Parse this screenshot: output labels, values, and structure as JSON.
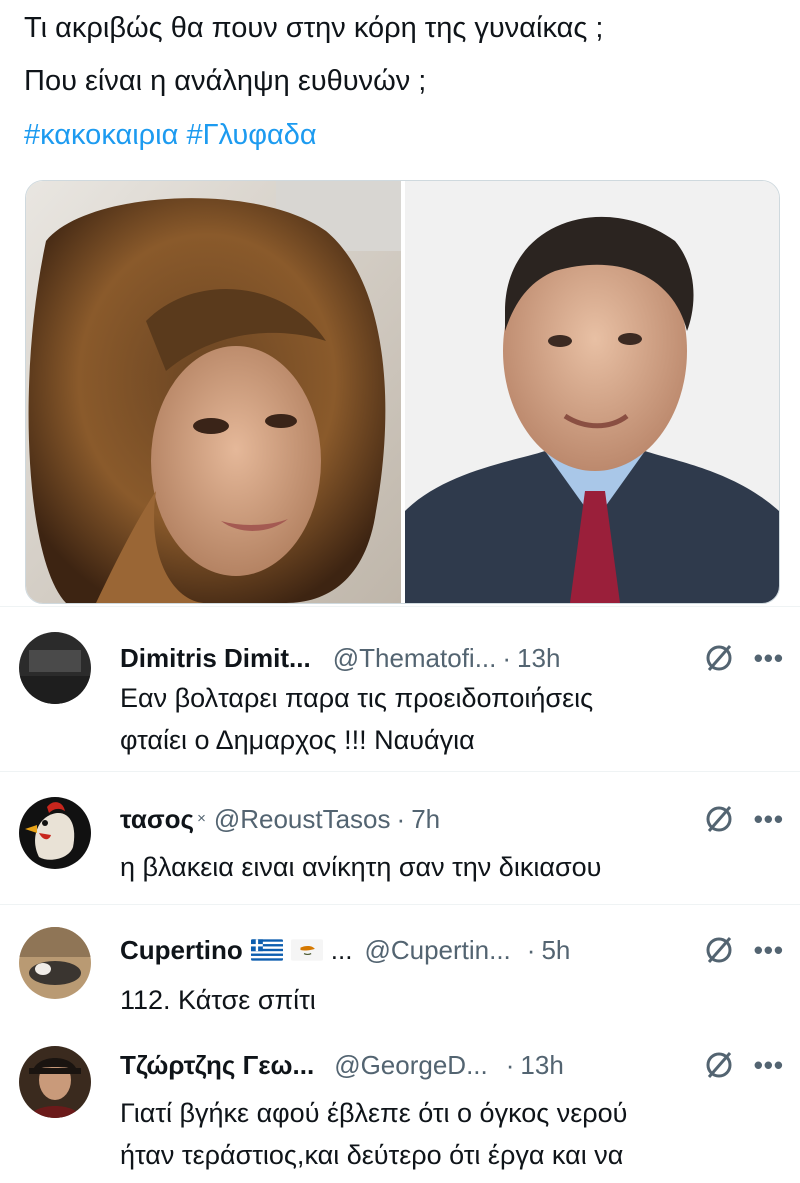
{
  "tweet": {
    "line1": "Τι ακριβώς θα πουν στην κόρη της γυναίκας ;",
    "line2": "Που είναι η ανάληψη ευθυνών ;",
    "hashtags": [
      "#κακοκαιρια",
      "#Γλυφαδα"
    ]
  },
  "colors": {
    "link": "#1d9bf0",
    "secondary": "#536471",
    "text": "#0f1419"
  },
  "replies": [
    {
      "name": "Dimitris Dimit...",
      "handle": "@Thematofi...",
      "time": "13h",
      "text_line1": "Εαν βολταρει παρα τις προειδοποιήσεις",
      "text_line2": "φταίει ο Δημαρχος  !!! Ναυάγια"
    },
    {
      "name": "τασος",
      "badge": "×",
      "handle": "@ReoustTasos",
      "time": "7h",
      "text_line1": "η βλακεια ειναι ανίκητη σαν την δικιασου"
    },
    {
      "name": "Cupertino",
      "flags": [
        "greece-flag",
        "cyprus-flag"
      ],
      "ellipsis": "...",
      "handle": "@Cupertin...",
      "time": "5h",
      "text_line1": "112. Κάτσε σπίτι"
    },
    {
      "name": "Τζώρτζης Γεω...",
      "handle": "@GeorgeD...",
      "time": "13h",
      "text_line1": "Γιατί βγήκε αφού έβλεπε ότι ο όγκος νερού",
      "text_line2": "ήταν τεράστιος,και δεύτερο ότι έργα και να"
    }
  ],
  "icons": {
    "separator": "·",
    "more": "•••"
  }
}
